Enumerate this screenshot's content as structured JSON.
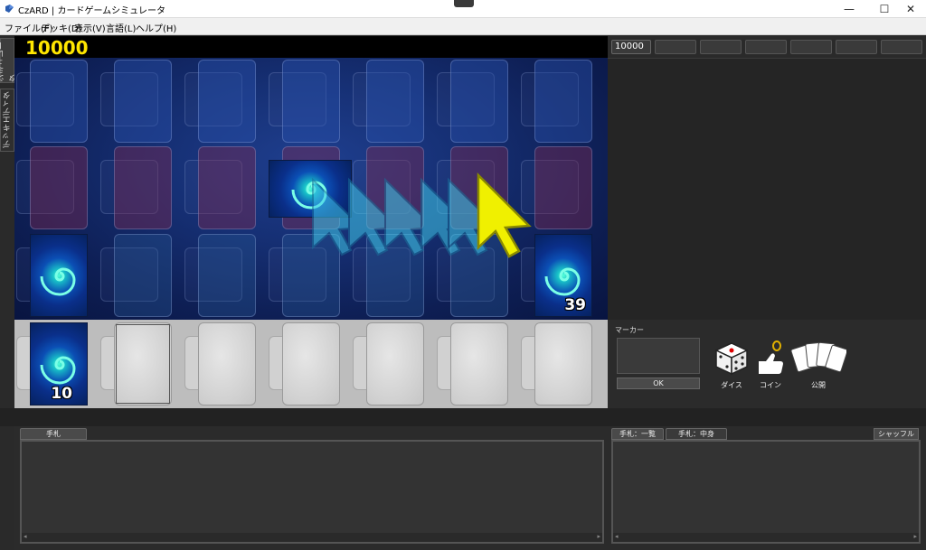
{
  "window": {
    "title": "CzARD | カードゲームシミュレータ",
    "minimize": "—",
    "maximize": "☐",
    "close": "✕"
  },
  "menu": {
    "items": [
      "ファイル(F)",
      "デッキ(D)",
      "表示(V)",
      "言語(L)",
      "ヘルプ(H)"
    ]
  },
  "side_tabs": {
    "simulator": "シミュレータ",
    "deck_editor": "デッキエディタ"
  },
  "scores": {
    "player_life": "10000",
    "right_life": "10000"
  },
  "counts": {
    "deck_right": "39",
    "deck_bottom_left": "10"
  },
  "marker": {
    "label": "マーカー",
    "ok": "OK"
  },
  "tools": {
    "dice": "ダイス",
    "coin": "コイン",
    "reveal": "公開"
  },
  "hand_panel": {
    "tab": "手札"
  },
  "list_panel": {
    "tab_list": "手札：一覧",
    "tab_contents": "手札：中身",
    "shuffle": "シャッフル"
  },
  "colors": {
    "score": "#ffe600",
    "field": "#163075",
    "cursor_yellow": "#f0f000",
    "cursor_cyan": "#3fc8e8"
  },
  "icons": [
    "app-icon",
    "dice-icon",
    "coin-icon",
    "cards-icon",
    "cursor-icon"
  ]
}
